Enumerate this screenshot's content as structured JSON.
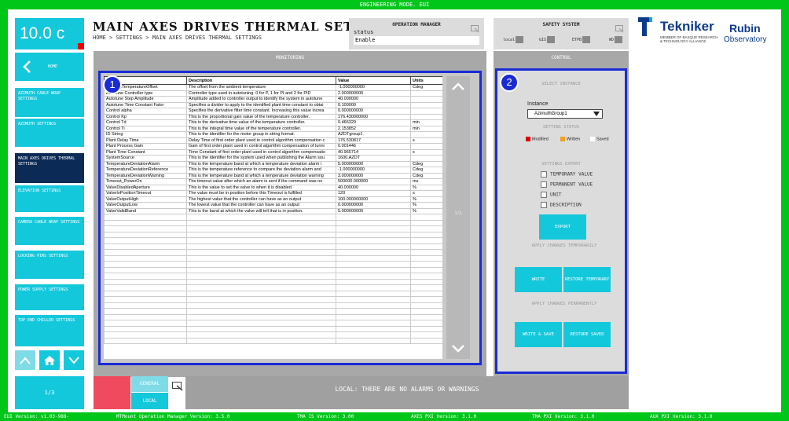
{
  "topbar": {
    "mode": "ENGINEERING MODE. EUI"
  },
  "nav": {
    "temperature": "10.0 c",
    "home": "HOME",
    "items": [
      "AZIMUTH CABLE WRAP SETTINGS",
      "AZIMUTH SETTINGS",
      "MAIN AXES DRIVES THERMAL SETTINGS",
      "ELEVATION SETTINGS",
      "CAMERA CABLE WRAP SETTINGS",
      "LOCKING PINS SETTINGS",
      "POWER SUPPLY SETTINGS",
      "TOP END CHILLER SETTINGS"
    ],
    "page": "1/3"
  },
  "header": {
    "title": "MAIN AXES DRIVES THERMAL SETTINGS",
    "breadcrumb": "HOME > SETTINGS > MAIN AXES DRIVES THERMAL SETTINGS"
  },
  "operation_manager": {
    "title": "OPERATION MANAGER",
    "status_label": "status",
    "status_value": "Enable"
  },
  "safety": {
    "title": "SAFETY SYSTEM",
    "items": [
      "local",
      "GIS",
      "ETPB",
      "WD"
    ]
  },
  "logos": {
    "tekniker": "Tekniker",
    "tekniker_sub1": "MEMBER OF BASQUE RESEARCH",
    "tekniker_sub2": "& TECHNOLOGY ALLIANCE",
    "rubin1": "Rubin",
    "rubin2": "Observatory"
  },
  "monitoring": {
    "title": "MONITORING",
    "badge": "1",
    "page": "1/2",
    "columns": [
      "",
      "Description",
      "Value",
      "Units"
    ],
    "rows": [
      [
        "AmbientTemperatureOffset",
        "The offset from the ambient temperature",
        "-1.000000000",
        "Cdeg"
      ],
      [
        "Autotune Controller type",
        "Controller type used in autotuning. 0 for P, 1 for PI and 2 for PID",
        "2.000000000",
        ""
      ],
      [
        "Autotune Step Amplitude",
        "Amplitude added to controller output to identify the system in autotune",
        "40.000000",
        ""
      ],
      [
        "Autotune Time Constant Fator",
        "Specifies a divider to apply to the identified plant time constant to obtai",
        "0.100000",
        ""
      ],
      [
        "Control alpha",
        "Specifies the derivative filter time constant. Increasing this value increa",
        "0.000000000",
        ""
      ],
      [
        "Control Kp",
        "This is the proportional gain value of the temperature controller.",
        "176.430000000",
        ""
      ],
      [
        "Control Td",
        "This is the derivative time value of the temperature controller.",
        "0.466329",
        "min"
      ],
      [
        "Control Ti",
        "This is the integral time value of the temperature controller.",
        "2.153852",
        "min"
      ],
      [
        "ID String",
        "This is the identifier for the motor group in string format.",
        "AZDTgroup1",
        ""
      ],
      [
        "Plant Delay Time",
        "Delay Time of first order plant used in control algorithm compensation c",
        "176.530817",
        "s"
      ],
      [
        "Plant Process Gain",
        "Gain of first order plant used in control algorithm compensation of tunni",
        "0.001446",
        ""
      ],
      [
        "Plant Time Constant",
        "Time Constant of first order plant used in control algorithm compensatio",
        "40.965714",
        "s"
      ],
      [
        "SystemSource",
        "This is the identifier for the system used when publishing the Alarm sou",
        "1600.AZDT",
        ""
      ],
      [
        "TemperatureDeviationAlarm",
        "This is the temperature band at which a temperature deviation alarm i",
        "5.000000000",
        "Cdeg"
      ],
      [
        "TemperatureDeviationReference",
        "This is the temperature reference to compare the deviation alarm and",
        "-1.000000000",
        "Cdeg"
      ],
      [
        "TemperatureDeviationWarning",
        "This is the temperature band at which a temperature deviation warning",
        "3.000000000",
        "Cdeg"
      ],
      [
        "Timeout_PowerOn",
        "The timeout value after which an alarm is sent if the command was no",
        "500000.000000",
        "ms"
      ],
      [
        "ValveDisabledAperture",
        "This is the value to set the valve to when it is disabled.",
        "40.000000",
        "%"
      ],
      [
        "ValveInPositionTimeout",
        "The value must be in position before this Timeout is fulfilled",
        "120",
        "s"
      ],
      [
        "ValveOutputHigh",
        "The highest value that the controller can have as an output",
        "100.000000000",
        "%"
      ],
      [
        "ValveOutputLow",
        "The lowest value that the controller can have as an output",
        "0.000000000",
        "%"
      ],
      [
        "ValveValidBand",
        "This is the band at which the valve will tell that is in position.",
        "5.000000000",
        "%"
      ]
    ]
  },
  "control": {
    "title": "CONTROL",
    "badge": "2",
    "select_instance": "SELECT INSTANCE",
    "instance_label": "Instance",
    "instance_value": "AzimuthGroup1",
    "setting_status": "SETTING STATUS",
    "legend": [
      {
        "label": "Modified",
        "color": "#e00000"
      },
      {
        "label": "Written",
        "color": "#f0a020"
      },
      {
        "label": "Saved",
        "color": "#ffffff"
      }
    ],
    "settings_export": "SETTINGS EXPORT",
    "export_options": [
      "TEMPORARY VALUE",
      "PERMANENT VALUE",
      "UNIT",
      "DESCRIPTION"
    ],
    "export_button": "EXPORT",
    "apply_temp": "APPLY CHANGES TEMPORARILY",
    "write": "WRITE",
    "restore_temp": "RESTORE TEMPORARY",
    "apply_perm": "APPLY CHANGES PERMANENTLY",
    "write_save": "WRITE & SAVE",
    "restore_saved": "RESTORE SAVED"
  },
  "alarm": {
    "general": "GENERAL",
    "local": "LOCAL",
    "message": "LOCAL: THERE ARE NO ALARMS OR WARNINGS"
  },
  "versions": [
    "EUI Version: v1.03-988-",
    "MTMount Operation Manager Version: 3.5.0",
    "TMA IS Version: 3.00",
    "AXES PXI Version: 3.1.0",
    "TMA PXI Version: 3.1.0",
    "AUX PXI Version: 3.1.0"
  ]
}
